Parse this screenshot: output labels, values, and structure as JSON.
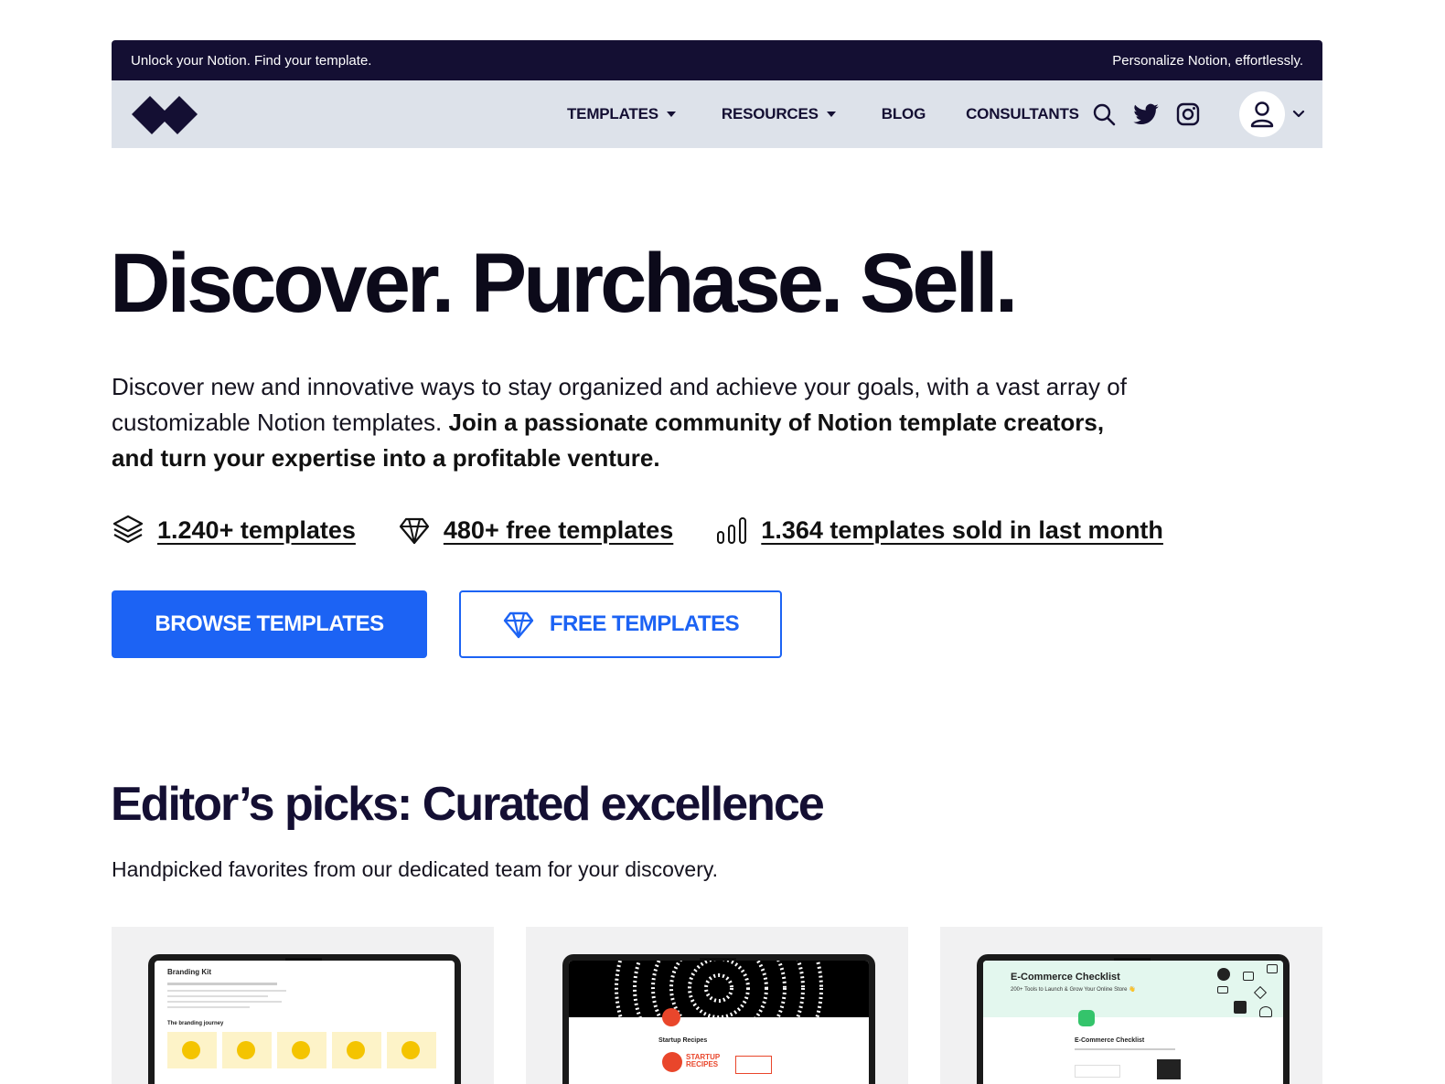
{
  "topbar": {
    "left_text": "Unlock your Notion. Find your template.",
    "right_text": "Personalize Notion, effortlessly."
  },
  "nav": {
    "items": [
      {
        "label": "TEMPLATES",
        "has_caret": true
      },
      {
        "label": "RESOURCES",
        "has_caret": true
      },
      {
        "label": "BLOG",
        "has_caret": false
      },
      {
        "label": "CONSULTANTS",
        "has_caret": false
      }
    ],
    "icons": [
      "search-icon",
      "twitter-icon",
      "instagram-icon",
      "user-icon",
      "chevron-down-icon"
    ]
  },
  "hero": {
    "title": "Discover. Purchase. Sell.",
    "desc_plain": "Discover new and innovative ways to stay organized and achieve your goals, with a vast array of customizable Notion templates. ",
    "desc_strong": "Join a passionate community of Notion template creators, and turn your expertise into a profitable venture."
  },
  "stats": [
    {
      "icon": "layers-icon",
      "label": "1.240+ templates"
    },
    {
      "icon": "diamond-icon",
      "label": "480+ free templates"
    },
    {
      "icon": "bar-chart-icon",
      "label": "1.364 templates sold in last month"
    }
  ],
  "buttons": {
    "browse": "BROWSE TEMPLATES",
    "free": "FREE TEMPLATES"
  },
  "editors": {
    "title": "Editor’s picks: Curated excellence",
    "subtitle": "Handpicked favorites from our dedicated team for your discovery."
  },
  "cards": [
    {
      "screen_title": "Branding Kit",
      "screen_sub": "The branding journey"
    },
    {
      "screen_title": "Startup Recipes",
      "screen_logo": "STARTUP RECIPES"
    },
    {
      "screen_title": "E-Commerce Checklist",
      "screen_sub": "200+ Tools to Launch & Grow Your Online Store 👋",
      "screen_sub2": "E-Commerce Checklist"
    }
  ],
  "colors": {
    "topbar_bg": "#140f33",
    "navbar_bg": "#dde2ea",
    "primary": "#1c63f4",
    "heading": "#140f33"
  }
}
